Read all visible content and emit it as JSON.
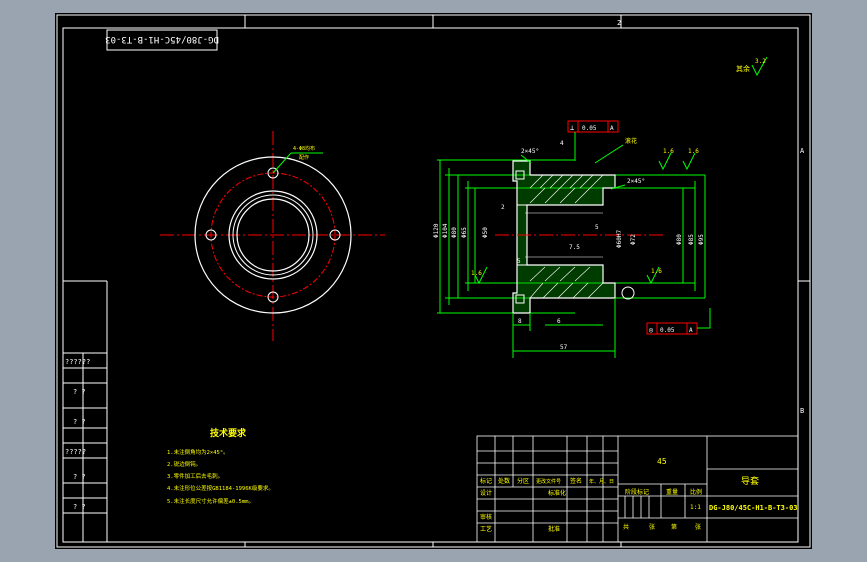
{
  "title_stamp": "DG-J80/45C-H1-B-T3-03",
  "zone_marks": {
    "top": [
      "1",
      "2"
    ],
    "right": [
      "A",
      "B"
    ]
  },
  "roughness_note": "其余",
  "roughness_value": "3.2",
  "front_view": {
    "hole_note_1": "4-Φ8均布",
    "hole_note_2": "配作"
  },
  "section_view": {
    "chamfer_1": "2×45°",
    "chamfer_2": "2×45°",
    "surface_note": "滚花",
    "rough_1": "1.6",
    "rough_2": "1.6",
    "rough_3": "1.6",
    "rough_4": "1.6",
    "tol_symbol": "⊥",
    "tol_value": "0.05",
    "tol_datum": "A",
    "runout_symbol": "◎",
    "runout_value": "0.05",
    "runout_datum": "A",
    "dims_vertical": [
      "Φ120",
      "Φ104",
      "Φ80",
      "Φ65",
      "Φ50",
      "Φ60H7",
      "Φ72",
      "Φ80",
      "Φ85",
      "Φ95"
    ],
    "dims_bottom": [
      "8",
      "6",
      "57"
    ],
    "dims_misc": [
      "4",
      "2",
      "5",
      "5",
      "7.5"
    ]
  },
  "tech_requirements": {
    "title": "技术要求",
    "items": [
      "1.未注倒角均为2×45°。",
      "2.锐边倒钝。",
      "3.零件加工后去毛刺。",
      "4.未注形位公差按GB1184-1996K级要求。",
      "5.未注长度尺寸允许偏差±0.5mm。"
    ]
  },
  "left_strip": [
    "??????",
    "? ?",
    "? ?",
    "?????",
    "? ?",
    "? ?"
  ],
  "title_block": {
    "material": "45",
    "part_name": "导套",
    "drawing_no": "DG-J80/45C-H1-B-T3-03",
    "scale": "1:1",
    "row_labels_1": [
      "标记",
      "处数",
      "分区",
      "更改文件号",
      "签名",
      "年、月、日"
    ],
    "designer": "设计",
    "standardize": "标准化",
    "checker": "审核",
    "process": "工艺",
    "approve": "批准",
    "stage_mark": "阶段标记",
    "weight": "重量",
    "scale_label": "比例",
    "sheets_total": "共",
    "sheet_unit": "张",
    "sheet_no": "第",
    "sheet_unit2": "张"
  }
}
